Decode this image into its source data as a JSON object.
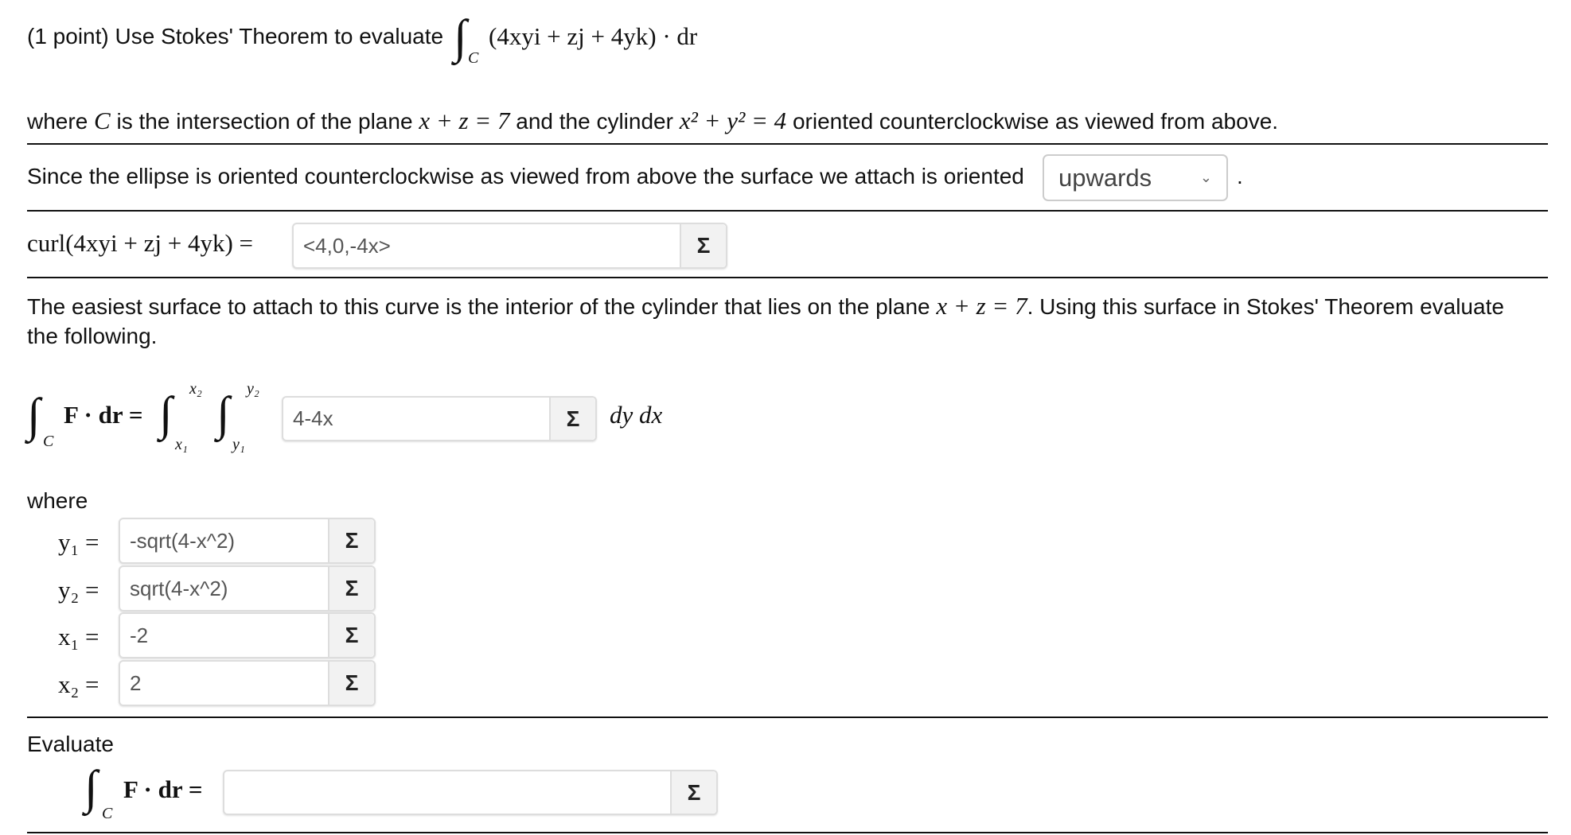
{
  "intro": {
    "prefix": "(1 point) Use Stokes' Theorem to evaluate",
    "integrand": "(4xyi + zj + 4yk) · dr",
    "contour": "C"
  },
  "where_line": {
    "a": "where ",
    "C": "C",
    "b": " is the intersection of the plane ",
    "plane": "x + z = 7",
    "c": " and the cylinder ",
    "cyl": "x² + y² = 4",
    "d": " oriented counterclockwise as viewed from above."
  },
  "orientation": {
    "text": "Since the ellipse is oriented counterclockwise as viewed from above the surface we attach is oriented",
    "selected": "upwards",
    "period": "."
  },
  "curl": {
    "label": "curl(4xyi + zj + 4yk) =",
    "value": "<4,0,-4x>"
  },
  "surface": {
    "line1a": "The easiest surface to attach to this curve is the interior of the cylinder that lies on the plane ",
    "plane": "x + z = 7",
    "line1b": ". Using this surface in Stokes' Theorem evaluate",
    "line2": "the following."
  },
  "double_integral": {
    "lhs": "F · dr =",
    "C": "C",
    "upper_x": "x₂",
    "lower_x": "x₁",
    "upper_y": "y₂",
    "lower_y": "y₁",
    "value": "4-4x",
    "tail": "dy dx"
  },
  "where_label": "where",
  "bounds": [
    {
      "label": "y₁ =",
      "value": "-sqrt(4-x^2)"
    },
    {
      "label": "y₂ =",
      "value": "sqrt(4-x^2)"
    },
    {
      "label": "x₁ =",
      "value": "-2"
    },
    {
      "label": "x₂ =",
      "value": "2"
    }
  ],
  "evaluate": {
    "label": "Evaluate",
    "lhs": "F · dr =",
    "C": "C",
    "value": ""
  },
  "sigma_icon": "Σ"
}
